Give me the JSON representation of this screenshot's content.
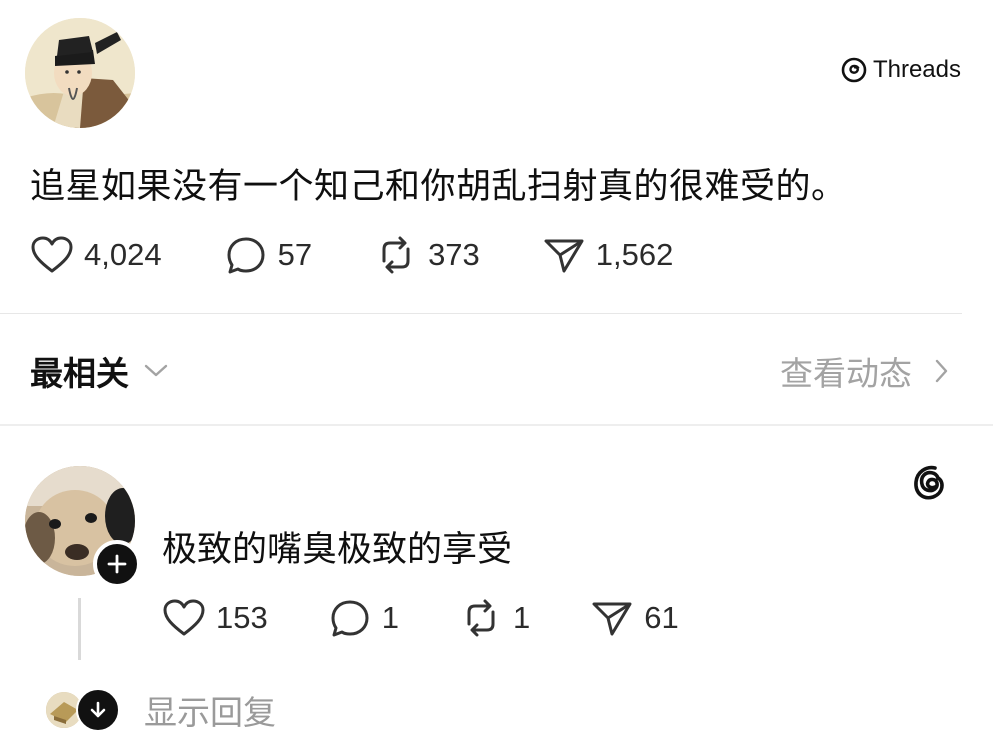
{
  "brand": {
    "label": "Threads",
    "icon": "threads-logo-icon"
  },
  "post": {
    "text": "追星如果没有一个知己和你胡乱扫射真的很难受的。",
    "likes": "4,024",
    "comments": "57",
    "reposts": "373",
    "shares": "1,562"
  },
  "sort": {
    "label": "最相关",
    "activity_label": "查看动态"
  },
  "reply": {
    "text": "极致的嘴臭极致的享受",
    "likes": "153",
    "comments": "1",
    "reposts": "1",
    "shares": "61"
  },
  "show_replies_label": "显示回复",
  "colors": {
    "muted": "#a3a3a3",
    "badge": "#111111",
    "divider": "#e7e7e7"
  }
}
